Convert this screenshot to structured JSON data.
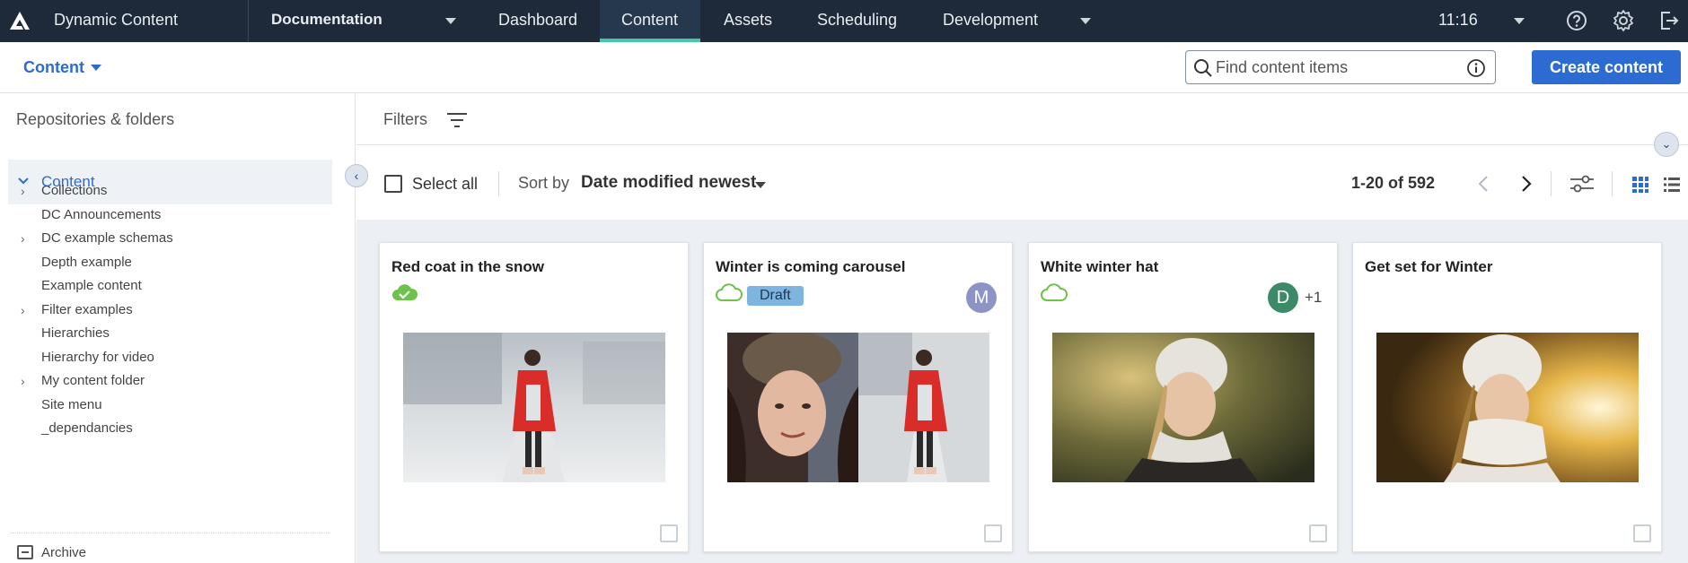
{
  "app": {
    "title": "Dynamic Content",
    "hub": "Documentation",
    "clock": "11:16"
  },
  "nav": {
    "items": [
      "Dashboard",
      "Content",
      "Assets",
      "Scheduling",
      "Development"
    ],
    "active": "Content"
  },
  "subheader": {
    "section": "Content",
    "search_placeholder": "Find content items",
    "create_label": "Create content"
  },
  "sidebar": {
    "title": "Repositories & folders",
    "root": "Content",
    "items": [
      {
        "label": "Collections",
        "expandable": true
      },
      {
        "label": "DC Announcements",
        "expandable": false
      },
      {
        "label": "DC example schemas",
        "expandable": true
      },
      {
        "label": "Depth example",
        "expandable": false
      },
      {
        "label": "Example content",
        "expandable": false
      },
      {
        "label": "Filter examples",
        "expandable": true
      },
      {
        "label": "Hierarchies",
        "expandable": false
      },
      {
        "label": "Hierarchy for video",
        "expandable": false
      },
      {
        "label": "My content folder",
        "expandable": true
      },
      {
        "label": "Site menu",
        "expandable": false
      },
      {
        "label": "_dependancies",
        "expandable": false
      }
    ],
    "archive": "Archive"
  },
  "filters": {
    "label": "Filters"
  },
  "toolbar": {
    "select_all": "Select all",
    "sort_label": "Sort by",
    "sort_value": "Date modified newest",
    "page_count": "1-20 of 592"
  },
  "colors": {
    "accent": "#2c6bd1",
    "nav_bg": "#1e2a3a",
    "active_bar": "#49c5a8",
    "cloud_green": "#6cc24a"
  },
  "cards": [
    {
      "title": "Red coat in the snow",
      "status_icon": "cloud-check-icon",
      "badge": "",
      "avatar": "",
      "avatar_color": "",
      "extra": ""
    },
    {
      "title": "Winter is coming carousel",
      "status_icon": "cloud-icon",
      "badge": "Draft",
      "avatar": "M",
      "avatar_color": "#8b94c4",
      "extra": ""
    },
    {
      "title": "White winter hat",
      "status_icon": "cloud-icon",
      "badge": "",
      "avatar": "D",
      "avatar_color": "#3c8a68",
      "extra": "+1"
    },
    {
      "title": "Get set for Winter",
      "status_icon": "",
      "badge": "",
      "avatar": "",
      "avatar_color": "",
      "extra": ""
    }
  ]
}
